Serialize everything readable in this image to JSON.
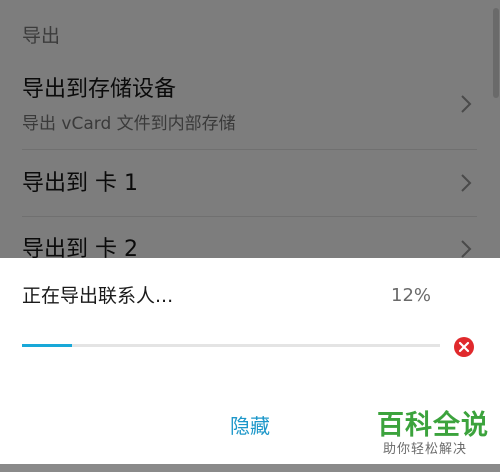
{
  "export_section": {
    "header": "导出",
    "items": [
      {
        "title": "导出到存储设备",
        "subtitle": "导出 vCard 文件到内部存储"
      },
      {
        "title": "导出到 卡 1"
      },
      {
        "title": "导出到 卡 2"
      }
    ]
  },
  "dialog": {
    "message": "正在导出联系人...",
    "progress_label": "12%",
    "progress": 0.12,
    "hide_label": "隐藏",
    "accent_color": "#18a8d8",
    "cancel_color": "#e0292c",
    "cancel_icon": "cancel-circle-icon",
    "chevron_icon": "chevron-right-icon"
  },
  "watermark": {
    "title": "百科全说",
    "subtitle": "助你轻松解决"
  }
}
